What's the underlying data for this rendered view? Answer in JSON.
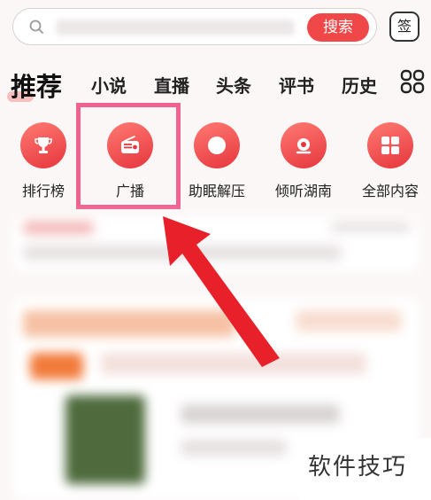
{
  "search": {
    "button_label": "搜索",
    "sign_label": "签"
  },
  "tabs": [
    {
      "label": "推荐",
      "active": true
    },
    {
      "label": "小说"
    },
    {
      "label": "直播"
    },
    {
      "label": "头条"
    },
    {
      "label": "评书"
    },
    {
      "label": "历史"
    }
  ],
  "shortcuts": [
    {
      "label": "排行榜",
      "icon": "trophy-icon"
    },
    {
      "label": "广播",
      "icon": "radio-icon"
    },
    {
      "label": "助眠解压",
      "icon": "moon-icon"
    },
    {
      "label": "倾听湖南",
      "icon": "location-icon"
    },
    {
      "label": "全部内容",
      "icon": "grid-icon"
    }
  ],
  "watermark": {
    "text": "软件技巧"
  },
  "colors": {
    "accent": "#f04848",
    "highlight": "#f06292",
    "arrow": "#e8202a"
  }
}
